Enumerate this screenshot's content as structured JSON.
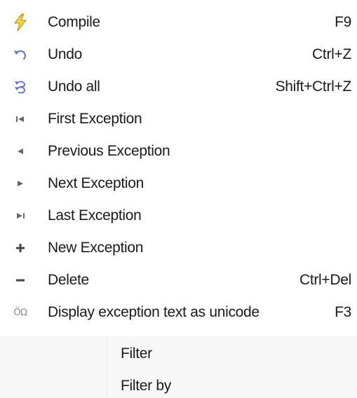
{
  "menu": {
    "items": [
      {
        "icon": "lightning-compile-icon",
        "label": "Compile",
        "shortcut": "F9"
      },
      {
        "icon": "undo-icon",
        "label": "Undo",
        "shortcut": "Ctrl+Z"
      },
      {
        "icon": "undo-all-icon",
        "label": "Undo all",
        "shortcut": "Shift+Ctrl+Z"
      },
      {
        "icon": "first-icon",
        "label": "First Exception",
        "shortcut": ""
      },
      {
        "icon": "previous-icon",
        "label": "Previous Exception",
        "shortcut": ""
      },
      {
        "icon": "next-icon",
        "label": "Next Exception",
        "shortcut": ""
      },
      {
        "icon": "last-icon",
        "label": "Last Exception",
        "shortcut": ""
      },
      {
        "icon": "plus-icon",
        "label": "New Exception",
        "shortcut": ""
      },
      {
        "icon": "minus-icon",
        "label": "Delete",
        "shortcut": "Ctrl+Del"
      },
      {
        "icon": "unicode-icon",
        "label": "Display exception text as unicode",
        "shortcut": "F3"
      }
    ],
    "unicode_icon_text": "ÖΩ"
  },
  "submenu": {
    "items": [
      {
        "label": "Filter"
      },
      {
        "label": "Filter by"
      }
    ]
  },
  "colors": {
    "icon_blue": "#5b6fc9",
    "icon_gray": "#666666",
    "icon_yellow": "#e8c93a",
    "submenu_bg": "#f7f7f7"
  }
}
